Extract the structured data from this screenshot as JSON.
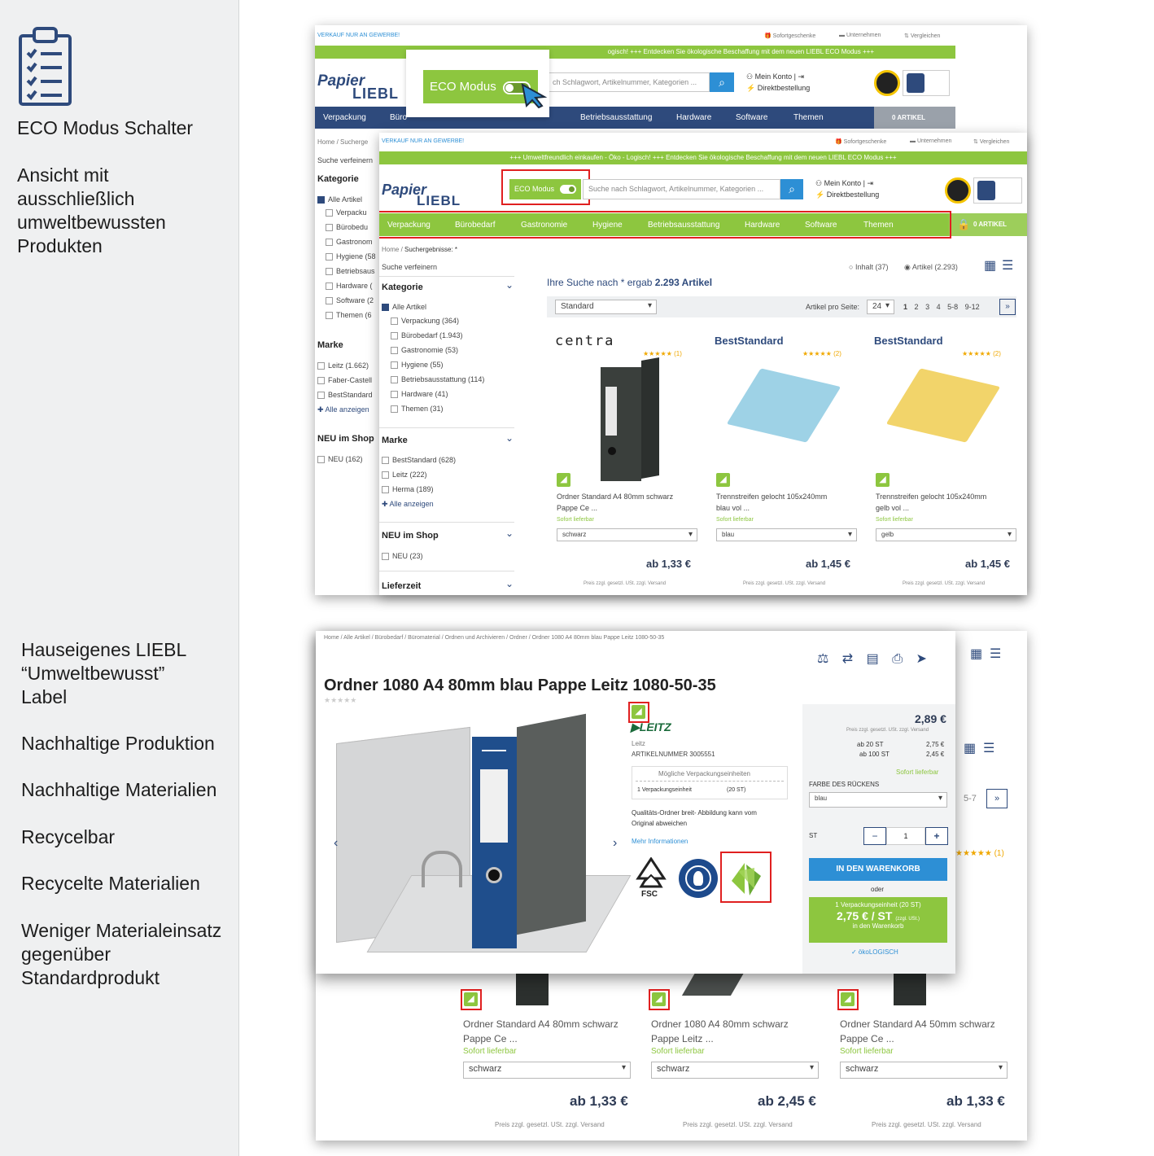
{
  "sidebar": {
    "eco_title": "ECO Modus Schalter",
    "eco_desc": "Ansicht mit\nausschließlich\numweltbewussten\nProdukten",
    "label_title": "Hauseigenes LIEBL\n“Umweltbewusst”\nLabel",
    "items": [
      "Nachhaltige Produktion",
      "Nachhaltige Materialien",
      "Recycelbar",
      "Recycelte Materialien",
      "Weniger Materialeinsatz\ngegenüber\nStandardprodukt"
    ]
  },
  "shop": {
    "topbar_left": "VERKAUF NUR AN GEWERBE!",
    "gift": "Sofortgeschenke",
    "company": "Unternehmen",
    "compare": "Vergleichen",
    "banner_old": "ogisch! +++ Entdecken Sie ökologische Beschaffung mit dem neuen LIEBL ECO Modus +++",
    "banner": "+++ Umweltfreundlich einkaufen - Öko - Logisch! +++ Entdecken Sie ökologische Beschaffung mit dem neuen LIEBL ECO Modus +++",
    "logo_top": "Papier",
    "logo_bottom": "LIEBL",
    "eco_toggle": "ECO Modus",
    "search_placeholder": "Suche nach Schlagwort, Artikelnummer, Kategorien ...",
    "search_placeholder_old": "ch Schlagwort, Artikelnummer, Kategorien ...",
    "account": "Mein Konto |",
    "direct": "Direktbestellung",
    "nav": [
      "Verpackung",
      "Bürobedarf",
      "Gastronomie",
      "Hygiene",
      "Betriebsausstattung",
      "Hardware",
      "Software",
      "Themen"
    ],
    "nav_old": [
      "Verpackung",
      "Büro",
      "",
      "",
      "Betriebsausstattung",
      "Hardware",
      "Software",
      "Themen"
    ],
    "cart": "0 ARTIKEL",
    "breadcrumb_home": "Home",
    "breadcrumb_results": "Suchergebnisse: *",
    "refine": "Suche verfeinern",
    "cat_head": "Kategorie",
    "all_items": "Alle Artikel",
    "categories": [
      "Verpackung  (364)",
      "Bürobedarf  (1.943)",
      "Gastronomie  (53)",
      "Hygiene  (55)",
      "Betriebsausstattung  (114)",
      "Hardware  (41)",
      "Themen  (31)"
    ],
    "old_categories": [
      "Verpacku",
      "Bürobedu",
      "Gastronom",
      "Hygiene (58",
      "Betriebsaus",
      "Hardware  (",
      "Software  (2",
      "Themen  (6"
    ],
    "brand_head": "Marke",
    "brands": [
      "BestStandard  (628)",
      "Leitz  (222)",
      "Herma  (189)"
    ],
    "old_brands": [
      "Leitz  (1.662)",
      "Faber-Castell",
      "BestStandard"
    ],
    "show_all": "Alle anzeigen",
    "new_head": "NEU im Shop",
    "new_item": "NEU  (23)",
    "old_new_item": "NEU  (162)",
    "delivery_head": "Lieferzeit",
    "result_text": "Ihre Suche nach * ergab",
    "result_count": "2.293 Artikel",
    "tab_content": "Inhalt (37)",
    "tab_items": "Artikel (2.293)",
    "sort": "Standard",
    "per_page_label": "Artikel pro Seite:",
    "per_page": "24",
    "pages": [
      "1",
      "2",
      "3",
      "4",
      "5-8",
      "9-12"
    ],
    "next": "»",
    "products": [
      {
        "brand": "centra",
        "rating": "★★★★★ (1)",
        "name": "Ordner Standard A4 80mm schwarz",
        "name2": "Pappe Ce ...",
        "stock": "Sofort lieferbar",
        "color": "schwarz",
        "price": "ab 1,33 €",
        "note": "Preis zzgl. gesetzl. USt. zzgl. Versand"
      },
      {
        "brand": "BestStandard",
        "rating": "★★★★★ (2)",
        "name": "Trennstreifen gelocht 105x240mm",
        "name2": "blau vol ...",
        "stock": "Sofort lieferbar",
        "color": "blau",
        "price": "ab 1,45 €",
        "note": "Preis zzgl. gesetzl. USt. zzgl. Versand"
      },
      {
        "brand": "BestStandard",
        "rating": "★★★★★ (2)",
        "name": "Trennstreifen gelocht 105x240mm",
        "name2": "gelb vol ...",
        "stock": "Sofort lieferbar",
        "color": "gelb",
        "price": "ab 1,45 €",
        "note": "Preis zzgl. gesetzl. USt. zzgl. Versand"
      }
    ]
  },
  "detail": {
    "breadcrumb": "Home  /  Alle Artikel  /  Bürobedarf  /  Büromaterial  /  Ordnen und Archivieren  /  Ordner  /  Ordner 1080 A4 80mm blau Pappe Leitz 1080-50-35",
    "title": "Ordner 1080 A4 80mm blau Pappe Leitz 1080-50-35",
    "brand": "LEITZ",
    "maker": "Leitz",
    "art_no": "ARTIKELNUMMER 3005551",
    "pack_head": "Mögliche Verpackungseinheiten",
    "pack_unit": "1 Verpackungseinheit",
    "pack_qty": "(20 ST)",
    "quality": "Qualitäts-Ordner breit- Abbildung kann vom",
    "quality2": "Original abweichen",
    "more": "Mehr Informationen",
    "fsc": "FSC",
    "price": "2,89 €",
    "price_note": "Preis zzgl. gesetzl. USt. zzgl. Versand",
    "tier1_label": "ab 20 ST",
    "tier1_price": "2,75 €",
    "tier2_label": "ab 100 ST",
    "tier2_price": "2,45 €",
    "stock": "Sofort lieferbar",
    "color_label": "FARBE DES RÜCKENS",
    "color": "blau",
    "qty_label": "ST",
    "qty": "1",
    "minus": "−",
    "plus": "+",
    "cart_btn": "IN DEN WARENKORB",
    "or": "oder",
    "pack_btn1": "1 Verpackungseinheit (20 ST)",
    "pack_btn2": "2,75 € / ST",
    "pack_btn2_small": "(zzgl. USt.)",
    "pack_btn3": "in den Warenkorb",
    "eco_tag": "✓ ökoLOGISCH",
    "bg_pages": "5-7",
    "bg_next": "»",
    "bg_rating": "★★★★★ (1)",
    "bg_products": [
      {
        "name": "Ordner Standard A4 80mm schwarz",
        "name2": "Pappe Ce ...",
        "stock": "Sofort lieferbar",
        "color": "schwarz",
        "price": "ab 1,33 €",
        "note": "Preis zzgl. gesetzl. USt. zzgl. Versand"
      },
      {
        "name": "Ordner 1080 A4 80mm schwarz",
        "name2": "Pappe Leitz ...",
        "stock": "Sofort lieferbar",
        "color": "schwarz",
        "price": "ab 2,45 €",
        "note": "Preis zzgl. gesetzl. USt. zzgl. Versand"
      },
      {
        "name": "Ordner Standard A4 50mm schwarz",
        "name2": "Pappe Ce ...",
        "stock": "Sofort lieferbar",
        "color": "schwarz",
        "price": "ab 1,33 €",
        "note": "Preis zzgl. gesetzl. USt. zzgl. Versand"
      }
    ]
  },
  "colors": {
    "green": "#8dc63f",
    "navy": "#2e4a7c",
    "blue": "#2d8fd5",
    "red": "#e02020"
  }
}
